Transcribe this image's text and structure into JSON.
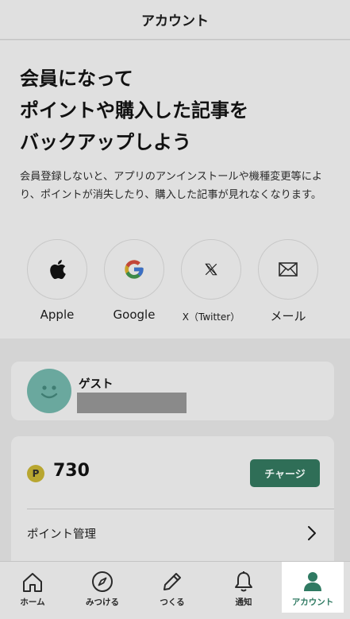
{
  "header": {
    "title": "アカウント"
  },
  "signup": {
    "headline": [
      "会員になって",
      "ポイントや購入した記事を",
      "バックアップしよう"
    ],
    "description": "会員登録しないと、アプリのアンインストールや機種変更等により、ポイントが消失したり、購入した記事が見れなくなります。",
    "providers": [
      {
        "label": "Apple",
        "icon": "apple-icon"
      },
      {
        "label": "Google",
        "icon": "google-icon"
      },
      {
        "label": "X（Twitter）",
        "icon": "x-icon"
      },
      {
        "label": "メール",
        "icon": "mail-icon"
      }
    ]
  },
  "user": {
    "name": "ゲスト",
    "avatar_icon": "smiley-icon",
    "avatar_color": "#6aa89e"
  },
  "points": {
    "badge": "P",
    "value": "730",
    "charge_label": "チャージ",
    "charge_color": "#2f6e57",
    "menu": [
      {
        "label": "ポイント管理",
        "icon": "chevron-right-icon"
      }
    ]
  },
  "tabbar": {
    "active_color": "#2f7a62",
    "tabs": [
      {
        "label": "ホーム",
        "icon": "home-icon",
        "active": false
      },
      {
        "label": "みつける",
        "icon": "compass-icon",
        "active": false
      },
      {
        "label": "つくる",
        "icon": "pencil-icon",
        "active": false
      },
      {
        "label": "通知",
        "icon": "bell-icon",
        "active": false
      },
      {
        "label": "アカウント",
        "icon": "person-icon",
        "active": true
      }
    ]
  }
}
